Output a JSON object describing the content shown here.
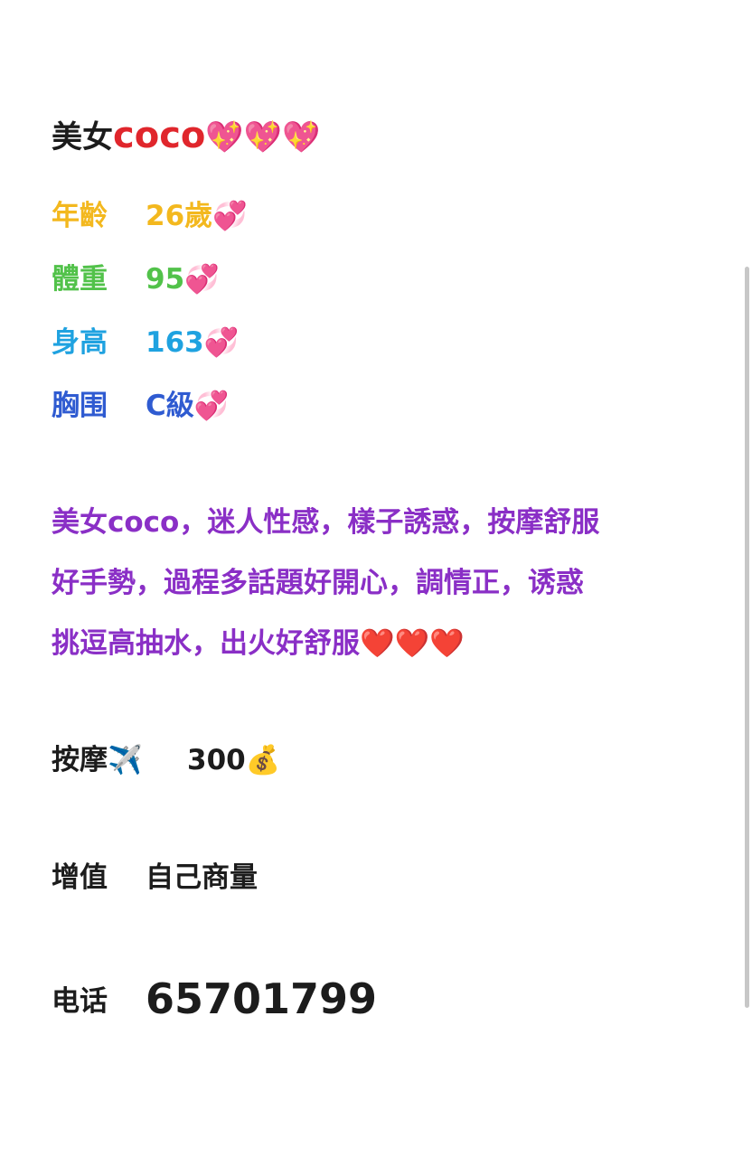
{
  "title": {
    "prefix": "美女",
    "name": "coco",
    "emoji": "💖💖💖"
  },
  "attributes": {
    "age": {
      "label": "年齡",
      "value": "26歲",
      "emoji": "💞"
    },
    "weight": {
      "label": "體重",
      "value": "95",
      "emoji": "💞"
    },
    "height": {
      "label": "身高",
      "value": "163",
      "emoji": "💞"
    },
    "chest": {
      "label": "胸围",
      "value": "C級",
      "emoji": "💞"
    }
  },
  "description": {
    "line1": "美女coco，迷人性感，樣子誘惑，按摩舒服",
    "line2": "好手勢，過程多話題好開心，調情正，诱惑",
    "line3": "挑逗高抽水，出火好舒服",
    "hearts": "❤️❤️❤️"
  },
  "massage": {
    "label": "按摩✈️",
    "value": "300",
    "emoji": "💰"
  },
  "addon": {
    "label": "增值",
    "value": "自己商量"
  },
  "phone": {
    "label": "电话",
    "value": "65701799"
  },
  "colors": {
    "title_name": "#e0262c",
    "age": "#f3b81e",
    "weight": "#52c24a",
    "height": "#1fa2e0",
    "chest": "#2f5bd1",
    "description": "#8a2fc6",
    "body_text": "#1c1c1c"
  }
}
